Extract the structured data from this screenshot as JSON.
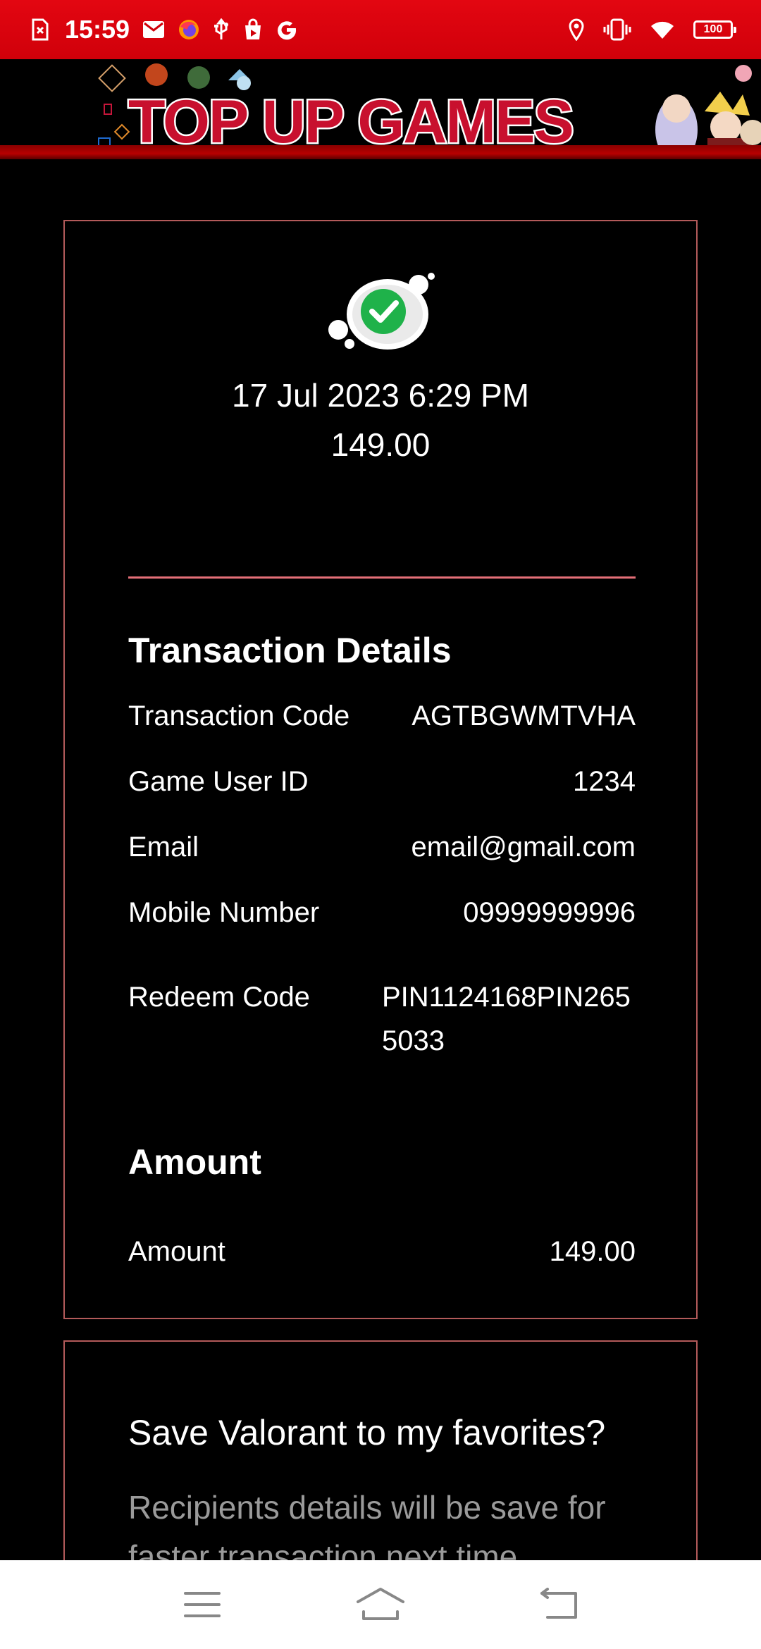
{
  "status_bar": {
    "time": "15:59",
    "battery": "100",
    "icons": [
      "sim-error-icon",
      "gmail-icon",
      "firefox-icon",
      "usb-icon",
      "shopping-bag-icon",
      "google-icon",
      "location-icon",
      "vibrate-icon",
      "wifi-icon",
      "battery-icon"
    ]
  },
  "banner": {
    "logo_text": "TOP UP GAMES"
  },
  "receipt": {
    "status_icon": "success-check-icon",
    "datetime": "17 Jul 2023 6:29 PM",
    "total": "149.00",
    "details_title": "Transaction Details",
    "details": [
      {
        "label": "Transaction Code",
        "value": "AGTBGWMTVHA"
      },
      {
        "label": "Game User ID",
        "value": "1234"
      },
      {
        "label": "Email",
        "value": "email@gmail.com"
      },
      {
        "label": "Mobile Number",
        "value": "09999999996"
      },
      {
        "label": "Redeem Code",
        "value": "PIN1124168PIN2655033"
      }
    ],
    "amount_title": "Amount",
    "amount_row": {
      "label": "Amount",
      "value": "149.00"
    }
  },
  "favorite": {
    "title": "Save Valorant  to my favorites?",
    "description": "Recipients details will be save for faster transaction next time"
  },
  "nav_bar": {
    "icons": [
      "menu-icon",
      "home-icon",
      "back-icon"
    ]
  },
  "colors": {
    "status_bar": "#e30611",
    "card_border": "#b35a5a",
    "divider": "#e46f78",
    "check_green": "#1fb24a"
  }
}
